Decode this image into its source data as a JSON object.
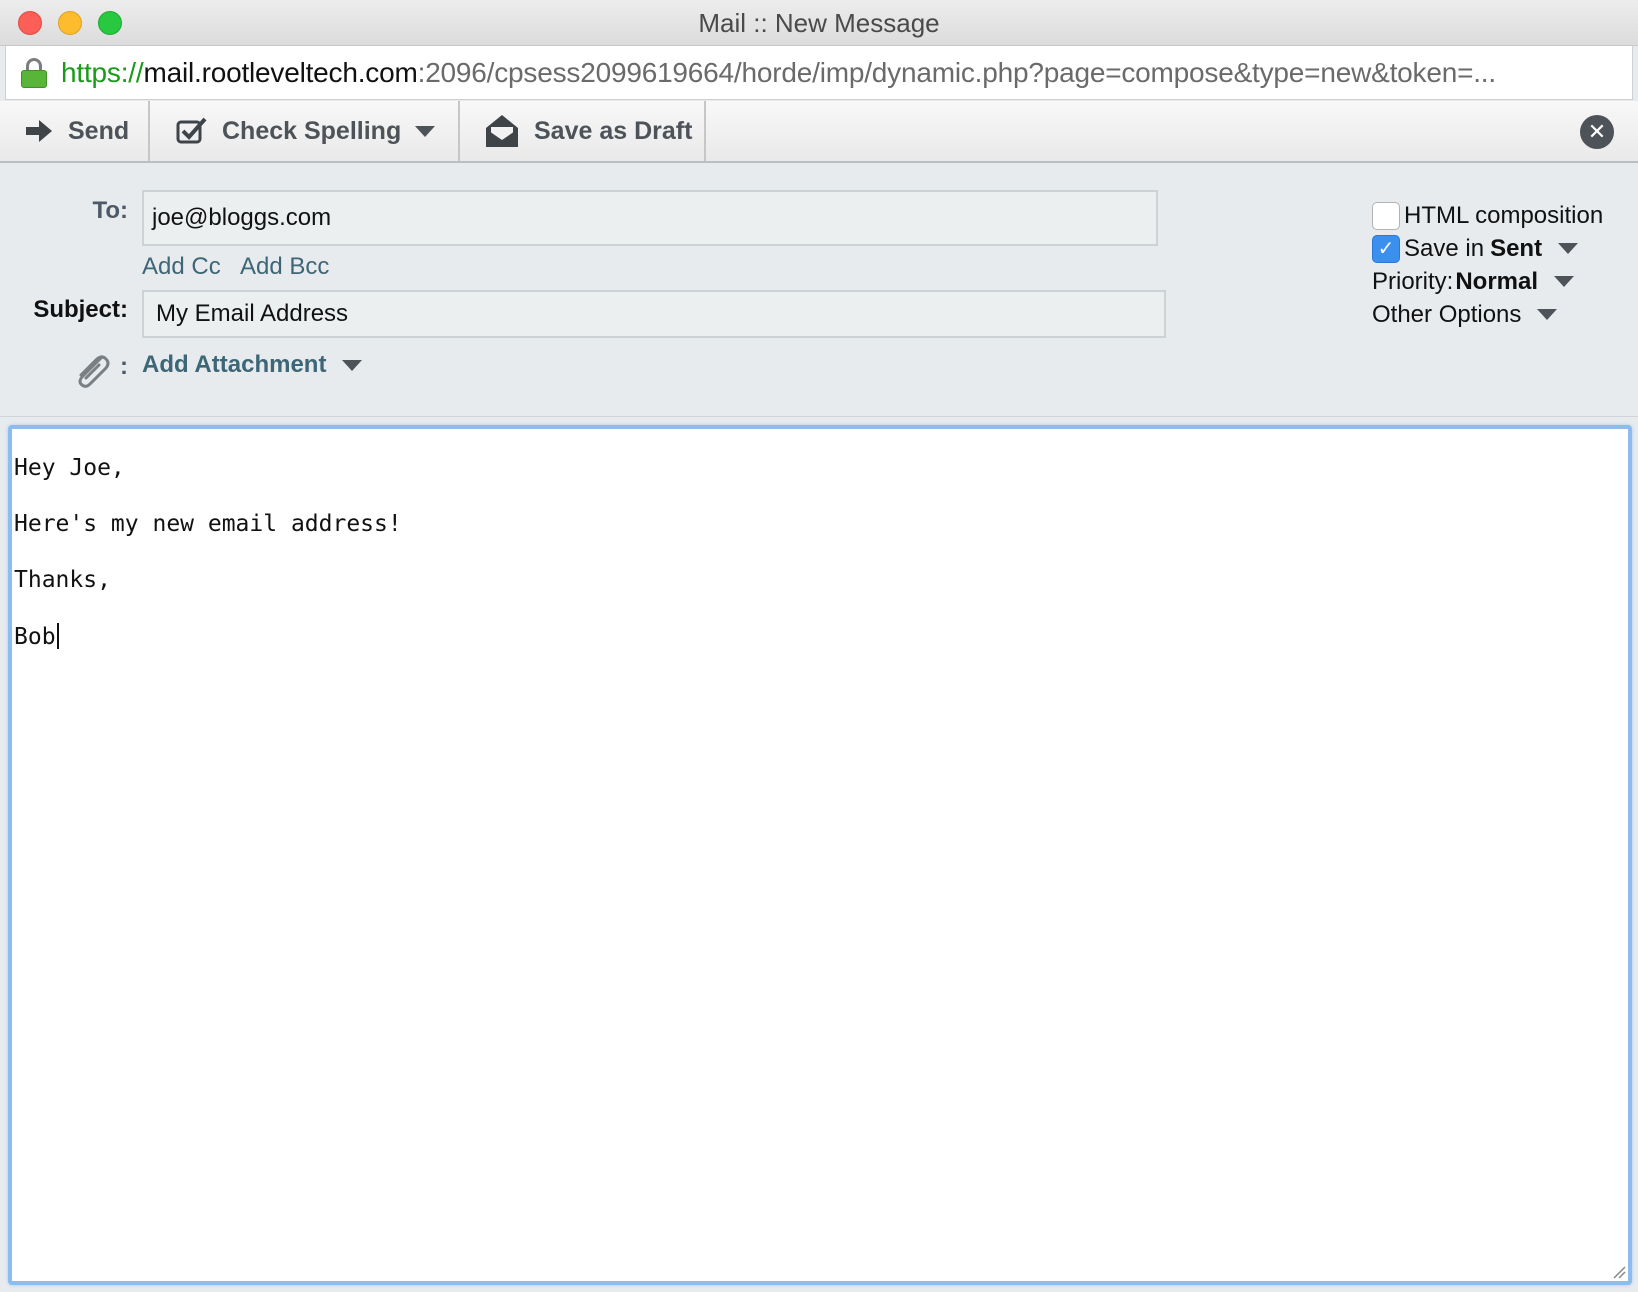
{
  "window": {
    "title": "Mail :: New Message"
  },
  "address_bar": {
    "scheme": "https://",
    "host": "mail.rootleveltech.com",
    "rest": ":2096/cpsess2099619664/horde/imp/dynamic.php?page=compose&type=new&token=..."
  },
  "toolbar": {
    "send_label": "Send",
    "spell_label": "Check Spelling",
    "draft_label": "Save as Draft"
  },
  "compose": {
    "to_label": "To:",
    "to_value": "joe@bloggs.com",
    "add_cc": "Add Cc",
    "add_bcc": "Add Bcc",
    "subject_label": "Subject:",
    "subject_value": "My Email Address",
    "attach_colon": ":",
    "add_attachment": "Add Attachment"
  },
  "options": {
    "html_composition": {
      "label": "HTML composition",
      "checked": false
    },
    "save_in_sent": {
      "prefix": "Save in",
      "value": "Sent",
      "checked": true
    },
    "priority": {
      "label": "Priority:",
      "value": "Normal"
    },
    "other_options": "Other Options"
  },
  "body": {
    "lines": [
      "Hey Joe,",
      "Here's my new email address!",
      "Thanks,",
      "Bob"
    ]
  },
  "colors": {
    "accent": "#3a8fef",
    "link": "#3d6677",
    "focus_border": "#8cbcf0"
  }
}
